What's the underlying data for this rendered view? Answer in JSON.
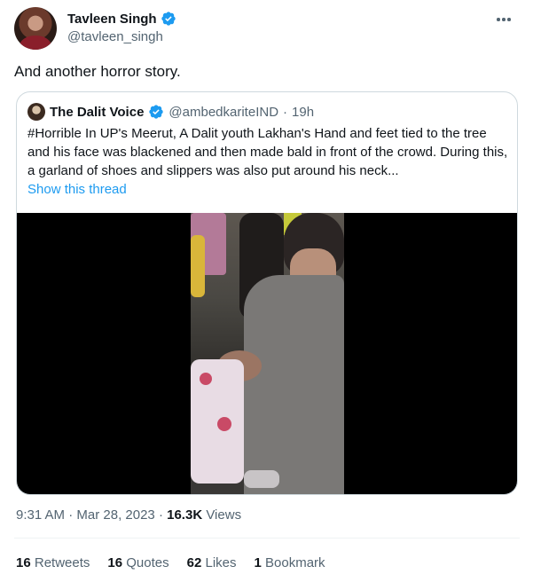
{
  "author": {
    "display_name": "Tavleen Singh",
    "handle": "@tavleen_singh"
  },
  "tweet": {
    "text": "And another horror story."
  },
  "quoted": {
    "display_name": "The Dalit Voice",
    "handle": "@ambedkariteIND",
    "separator": "·",
    "time": "19h",
    "text": "#Horrible In UP's Meerut, A Dalit youth Lakhan's Hand and feet tied to the tree and his face was blackened and then made bald in front of the crowd. During this, a garland of shoes and slippers was also put around his neck...",
    "show_thread": "Show this thread"
  },
  "meta": {
    "time": "9:31 AM",
    "date": "Mar 28, 2023",
    "separator": "·",
    "views_count": "16.3K",
    "views_label": "Views"
  },
  "stats": {
    "retweets_count": "16",
    "retweets_label": "Retweets",
    "quotes_count": "16",
    "quotes_label": "Quotes",
    "likes_count": "62",
    "likes_label": "Likes",
    "bookmarks_count": "1",
    "bookmarks_label": "Bookmark"
  },
  "colors": {
    "link": "#1d9bf0",
    "secondary_text": "#536471",
    "verified": "#1d9bf0"
  },
  "icons": [
    "verified-badge-icon",
    "more-options-icon"
  ]
}
